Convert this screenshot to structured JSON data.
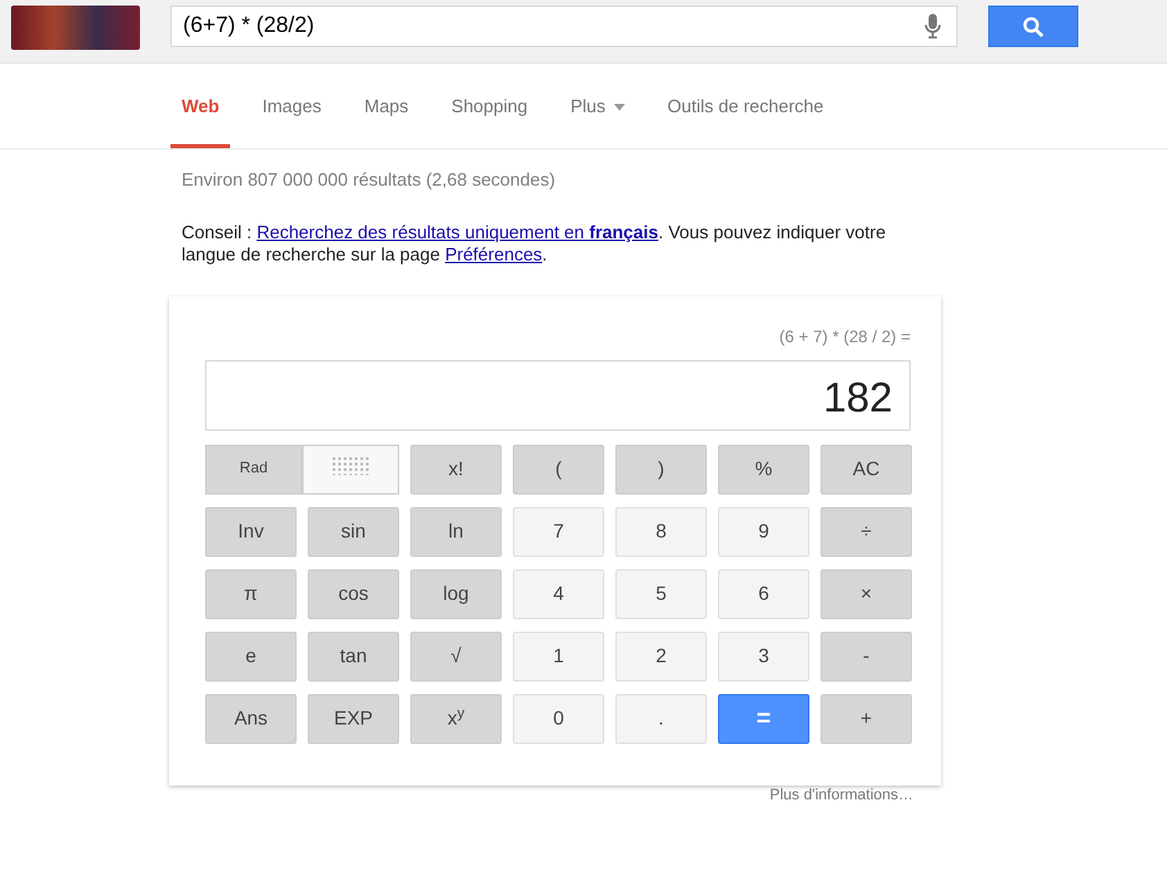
{
  "search": {
    "value": "(6+7) * (28/2)"
  },
  "tabs": [
    {
      "label": "Web",
      "selected": true,
      "kind": "tab"
    },
    {
      "label": "Images",
      "selected": false,
      "kind": "tab"
    },
    {
      "label": "Maps",
      "selected": false,
      "kind": "tab"
    },
    {
      "label": "Shopping",
      "selected": false,
      "kind": "tab"
    },
    {
      "label": "Plus",
      "selected": false,
      "kind": "menu"
    },
    {
      "label": "Outils de recherche",
      "selected": false,
      "kind": "tab"
    }
  ],
  "result_stats": "Environ 807 000 000 résultats (2,68 secondes)",
  "tip": {
    "prefix": "Conseil : ",
    "link": "Recherchez des résultats uniquement en **français**",
    "middle": ". Vous pouvez indiquer votre langue de recherche sur la page ",
    "link2": "Préférences",
    "suffix": "."
  },
  "calculator": {
    "expression": "(6 + 7) * (28 / 2) =",
    "result": "182",
    "angle_toggle": [
      {
        "kind": "label",
        "label": "Rad",
        "selected": true
      },
      {
        "kind": "dots",
        "selected": false
      }
    ],
    "keys": [
      {
        "label": "x!",
        "kind": "op"
      },
      {
        "label": "(",
        "kind": "op"
      },
      {
        "label": ")",
        "kind": "op"
      },
      {
        "label": "%",
        "kind": "op"
      },
      {
        "label": "AC",
        "kind": "op"
      },
      {
        "label": "Inv",
        "kind": "op"
      },
      {
        "label": "sin",
        "kind": "op"
      },
      {
        "label": "ln",
        "kind": "op"
      },
      {
        "label": "7",
        "kind": "num"
      },
      {
        "label": "8",
        "kind": "num"
      },
      {
        "label": "9",
        "kind": "num"
      },
      {
        "label": "÷",
        "kind": "op"
      },
      {
        "label": "π",
        "kind": "op"
      },
      {
        "label": "cos",
        "kind": "op"
      },
      {
        "label": "log",
        "kind": "op"
      },
      {
        "label": "4",
        "kind": "num"
      },
      {
        "label": "5",
        "kind": "num"
      },
      {
        "label": "6",
        "kind": "num"
      },
      {
        "label": "×",
        "kind": "op"
      },
      {
        "label": "e",
        "kind": "op"
      },
      {
        "label": "tan",
        "kind": "op"
      },
      {
        "label": "√",
        "kind": "op"
      },
      {
        "label": "1",
        "kind": "num"
      },
      {
        "label": "2",
        "kind": "num"
      },
      {
        "label": "3",
        "kind": "num"
      },
      {
        "label": "-",
        "kind": "op"
      },
      {
        "label": "Ans",
        "kind": "op"
      },
      {
        "label": "EXP",
        "kind": "op"
      },
      {
        "label": "x$^{y}$",
        "kind": "op"
      },
      {
        "label": "0",
        "kind": "num"
      },
      {
        "label": ".",
        "kind": "num"
      },
      {
        "label": "=",
        "kind": "equals"
      },
      {
        "label": "+",
        "kind": "op"
      }
    ],
    "more_link": "Plus d'informations…"
  }
}
